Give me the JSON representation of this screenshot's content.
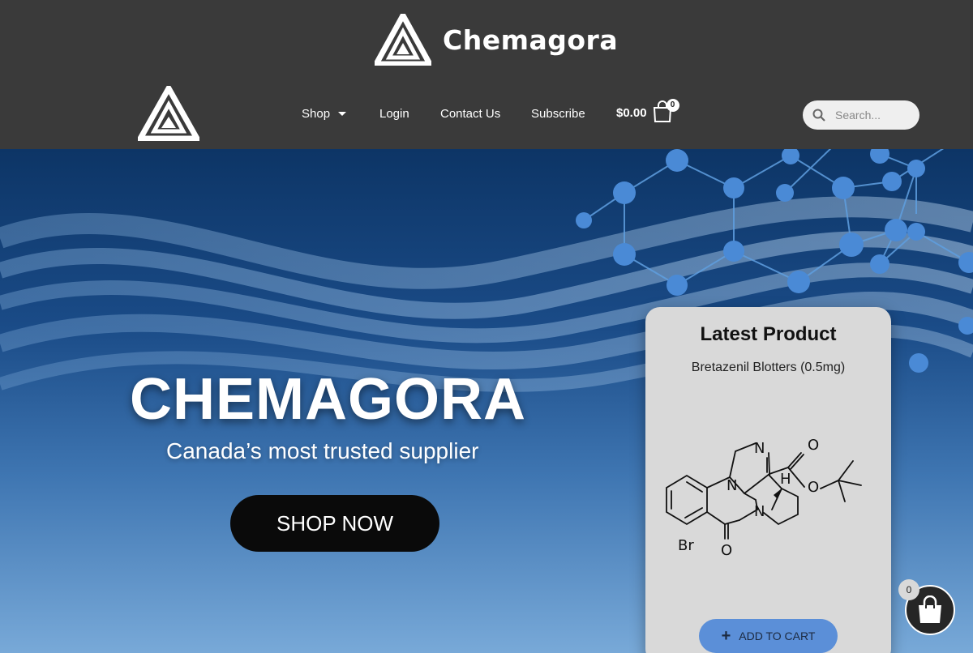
{
  "brand": {
    "name": "Chemagora"
  },
  "nav": {
    "items": [
      {
        "label": "Shop",
        "has_dropdown": true
      },
      {
        "label": "Login"
      },
      {
        "label": "Contact Us"
      },
      {
        "label": "Subscribe"
      }
    ],
    "cart_total": "$0.00",
    "cart_count": "0"
  },
  "search": {
    "placeholder": "Search...",
    "value": ""
  },
  "hero": {
    "title": "CHEMAGORA",
    "subtitle": "Canada’s most trusted supplier",
    "cta_label": "SHOP NOW"
  },
  "product_card": {
    "heading": "Latest Product",
    "product_name": "Bretazenil Blotters (0.5mg)",
    "structure_atoms": {
      "n1": "N",
      "n2": "N",
      "n3": "N",
      "o1": "O",
      "o2": "O",
      "o3": "O",
      "h": "H",
      "br": "Br"
    },
    "add_to_cart_label": "ADD TO CART"
  },
  "floating_cart": {
    "count": "0"
  },
  "colors": {
    "header_bg": "#3a3a3a",
    "hero_top": "#0d3566",
    "hero_bottom": "#78a9d8",
    "card_bg": "#d9d9d9",
    "add_to_cart_bg": "#5b8fd8",
    "cta_bg": "#0a0a0a"
  },
  "icons": [
    "logo-triangle-icon",
    "caret-down-icon",
    "shopping-bag-icon",
    "search-icon",
    "plus-icon"
  ]
}
